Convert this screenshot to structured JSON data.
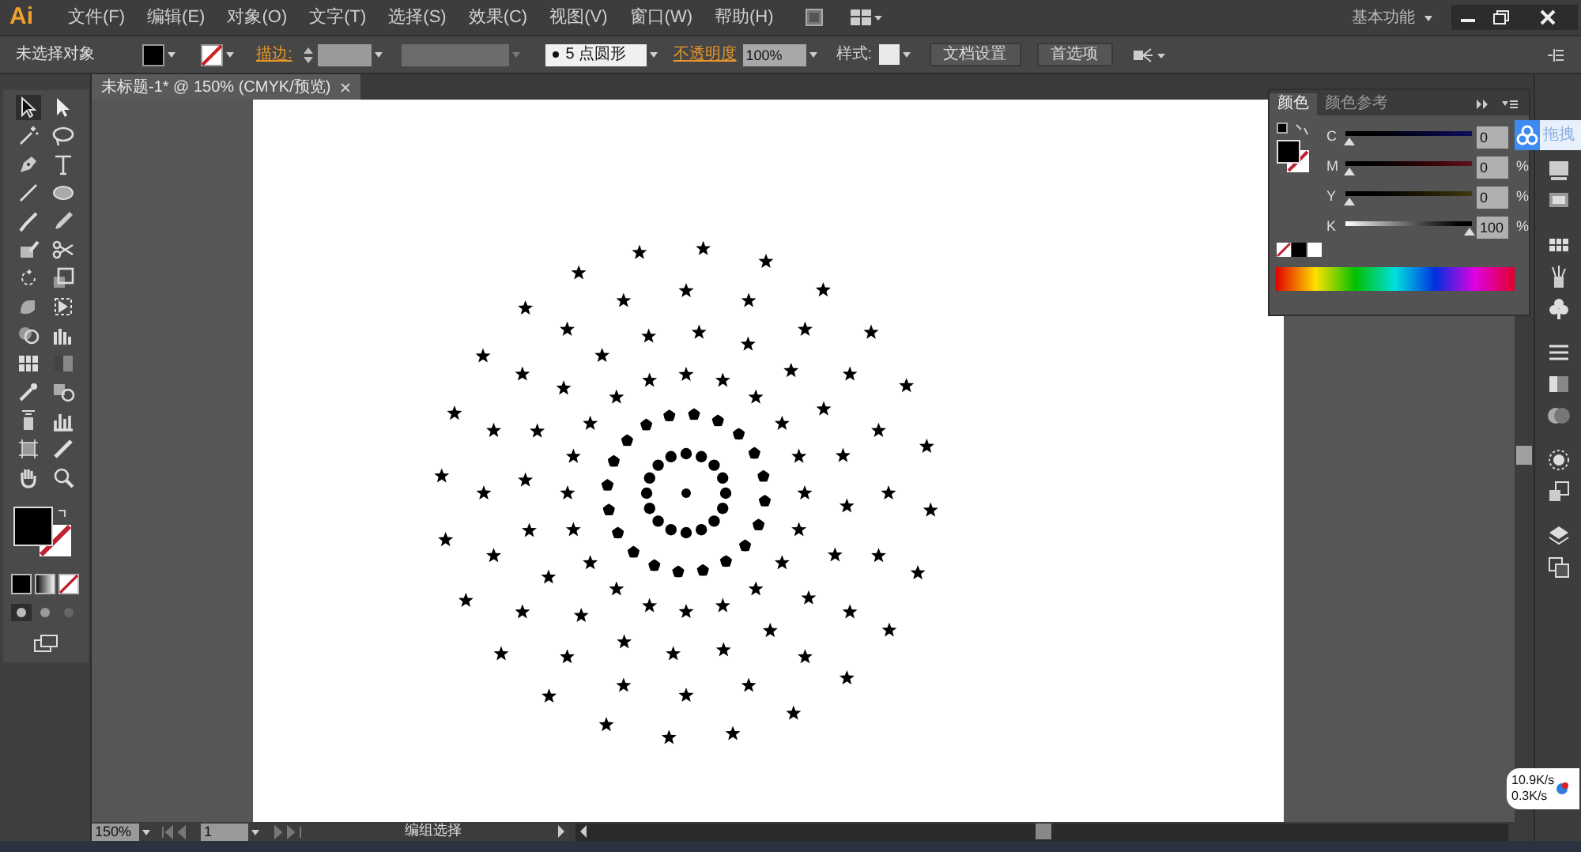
{
  "app_logo": "Ai",
  "menu": [
    "文件(F)",
    "编辑(E)",
    "对象(O)",
    "文字(T)",
    "选择(S)",
    "效果(C)",
    "视图(V)",
    "窗口(W)",
    "帮助(H)"
  ],
  "workspace": "基本功能",
  "control_bar": {
    "selection": "未选择对象",
    "stroke_label": "描边:",
    "brush": "5 点圆形",
    "opacity_label": "不透明度",
    "opacity": "100%",
    "style_label": "样式:",
    "buttons": [
      "文档设置",
      "首选项"
    ]
  },
  "document_tab": {
    "title": "未标题-1* @ 150% (CMYK/预览)"
  },
  "color_panel": {
    "tabs": [
      {
        "label": "颜色",
        "selected": true
      },
      {
        "label": "颜色参考",
        "selected": false
      }
    ],
    "channels": [
      {
        "name": "C",
        "value": "0",
        "level": 0
      },
      {
        "name": "M",
        "value": "0",
        "unit": "%",
        "level": 0
      },
      {
        "name": "Y",
        "value": "0",
        "unit": "%",
        "level": 0
      },
      {
        "name": "K",
        "value": "100",
        "unit": "%",
        "level": 1
      }
    ]
  },
  "overlay_widget": {
    "label": "拖拽"
  },
  "status_bar": {
    "zoom": "150%",
    "page": "1",
    "tool": "编组选择"
  },
  "network_widget": {
    "download": "10.9K/s",
    "upload": "0.3K/s"
  }
}
